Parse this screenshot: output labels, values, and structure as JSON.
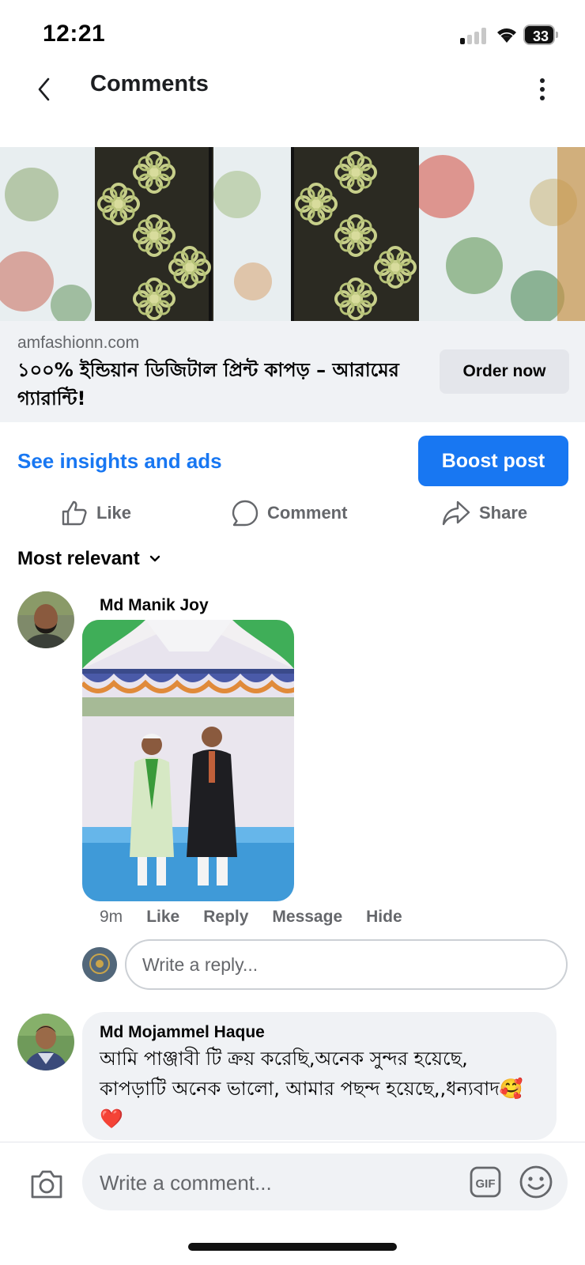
{
  "status_bar": {
    "time": "12:21",
    "battery": "33",
    "battery_level": 0.33
  },
  "header": {
    "title": "Comments",
    "back_icon": "chevron-left-icon",
    "more_icon": "vertical-dots-icon"
  },
  "ad": {
    "domain": "amfashionn.com",
    "headline": "১০০% ইন্ডিয়ান ডিজিটাল প্রিন্ট কাপড় – আরামের গ্যারান্টি!",
    "cta_label": "Order now"
  },
  "insights": {
    "link_label": "See insights and ads",
    "boost_label": "Boost post"
  },
  "actions": {
    "like_label": "Like",
    "comment_label": "Comment",
    "share_label": "Share"
  },
  "sort": {
    "label": "Most relevant"
  },
  "comments": [
    {
      "author": "Md Manik Joy",
      "time": "9m",
      "like": "Like",
      "reply": "Reply",
      "message": "Message",
      "hide": "Hide"
    },
    {
      "author": "Md Mojammel Haque",
      "text": "আমি পাঞ্জাবী টি ক্রয় করেছি,অনেক সুন্দর হয়েছে, কাপড়াটি অনেক ভালো, আমার পছন্দ হয়েছে,,ধন্যবাদ🥰❤️"
    }
  ],
  "reply_box": {
    "placeholder": "Write a reply..."
  },
  "composer": {
    "placeholder": "Write a comment...",
    "gif_label": "GIF"
  },
  "colors": {
    "accent": "#1877f2",
    "secondary_text": "#65676b",
    "surface": "#f0f2f5"
  }
}
